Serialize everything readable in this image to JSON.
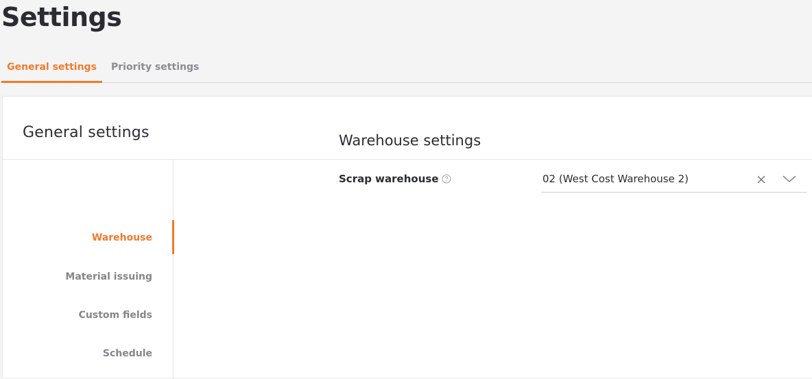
{
  "page": {
    "title": "Settings"
  },
  "tabs": [
    {
      "label": "General settings",
      "active": true
    },
    {
      "label": "Priority settings",
      "active": false
    }
  ],
  "panel": {
    "title": "General settings"
  },
  "sidebar": {
    "items": [
      {
        "label": "Warehouse",
        "active": true
      },
      {
        "label": "Material issuing",
        "active": false
      },
      {
        "label": "Custom fields",
        "active": false
      },
      {
        "label": "Schedule",
        "active": false
      }
    ]
  },
  "warehouse_settings": {
    "title": "Warehouse settings",
    "scrap_warehouse": {
      "label": "Scrap warehouse",
      "value": "02 (West Cost Warehouse 2)"
    }
  },
  "colors": {
    "accent": "#f07b2b",
    "background": "#f4f4f5",
    "panel": "#ffffff",
    "text": "#2b2c33",
    "muted_text": "#85868b"
  },
  "icons": {
    "help": "question-circle-icon",
    "clear": "close-icon",
    "dropdown": "chevron-down-icon"
  }
}
